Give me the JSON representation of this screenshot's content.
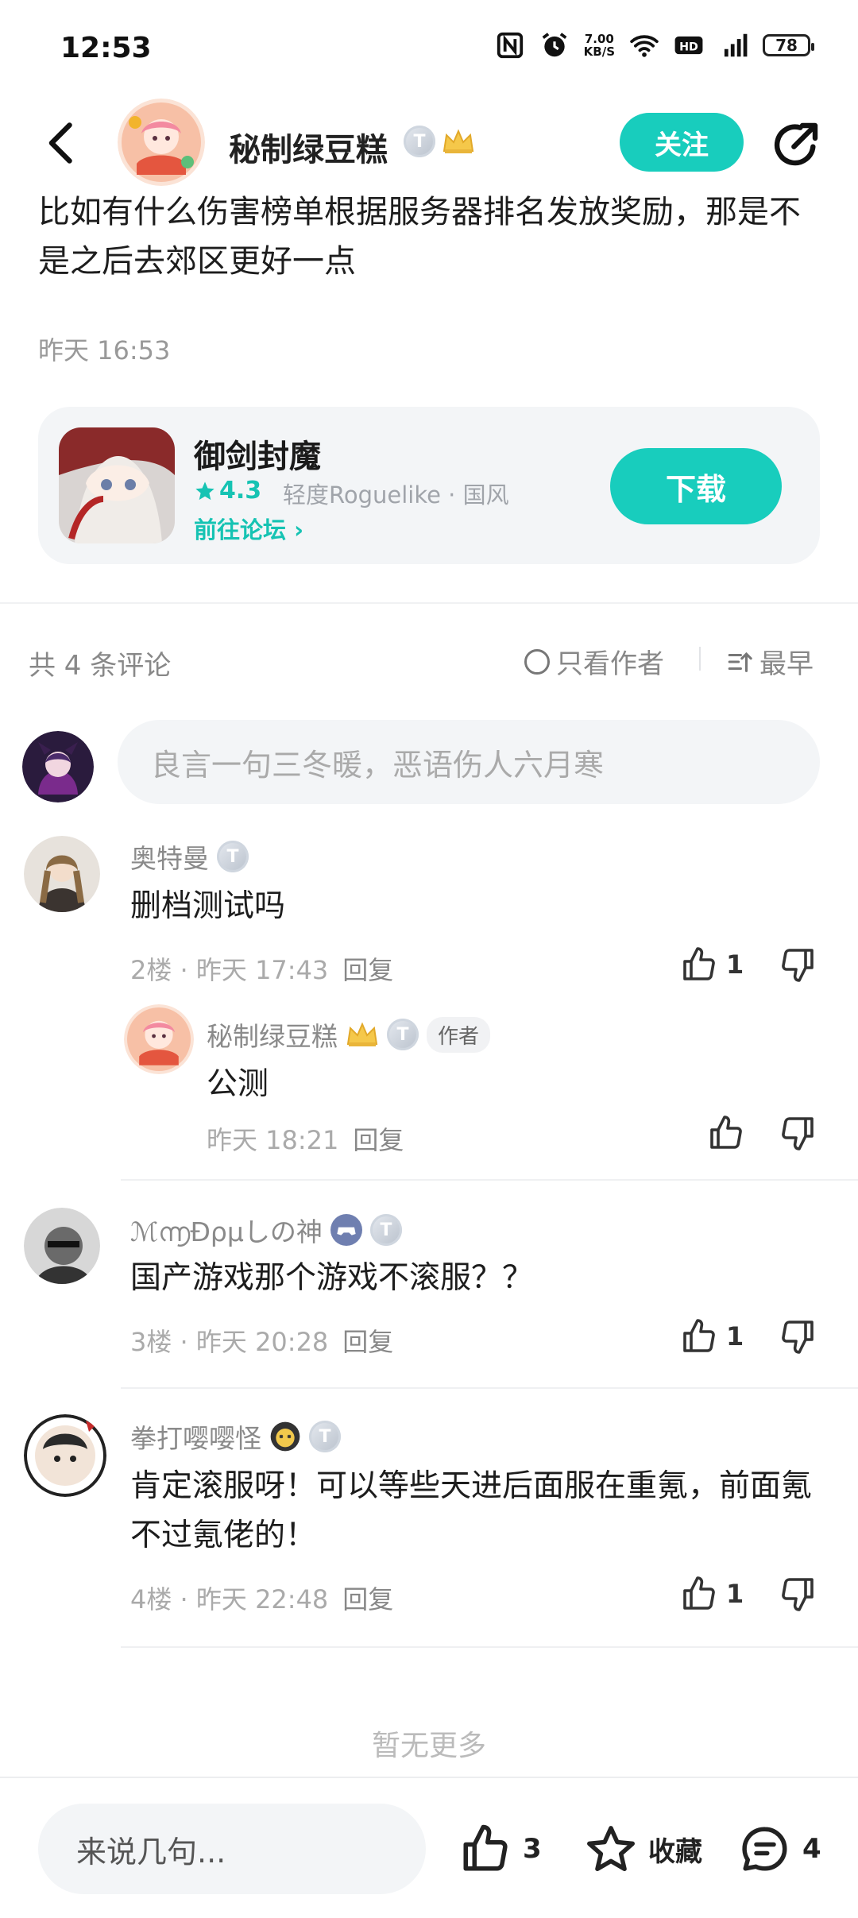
{
  "status_bar": {
    "time": "12:53",
    "net_speed": "7.00",
    "net_unit": "KB/S",
    "network": "5G",
    "battery": "78"
  },
  "header": {
    "author_name": "秘制绿豆糕",
    "badge_letter": "T",
    "follow_label": "关注"
  },
  "post": {
    "text": "比如有什么伤害榜单根据服务器排名发放奖励，那是不是之后去郊区更好一点",
    "time": "昨天 16:53"
  },
  "game_card": {
    "name": "御剑封魔",
    "rating": "4.3",
    "tags": "轻度Roguelike · 国风",
    "forum_link": "前往论坛",
    "download_label": "下载"
  },
  "comments_header": {
    "count": "共 4 条评论",
    "only_author": "只看作者",
    "sort": "最早"
  },
  "comment_input": {
    "placeholder": "良言一句三冬暖，恶语伤人六月寒"
  },
  "comments": [
    {
      "user": "奥特曼",
      "text": "删档测试吗",
      "floor": "2楼",
      "time": "昨天 17:43",
      "reply_label": "回复",
      "likes": "1",
      "reply": {
        "user": "秘制绿豆糕",
        "author_tag": "作者",
        "text": "公测",
        "time": "昨天 18:21",
        "reply_label": "回复"
      }
    },
    {
      "user": "ℳ൬Ɖρμしの神",
      "text": "国产游戏那个游戏不滚服？？",
      "floor": "3楼",
      "time": "昨天 20:28",
      "reply_label": "回复",
      "likes": "1"
    },
    {
      "user": "拳打嘤嘤怪",
      "text": "肯定滚服呀！可以等些天进后面服在重氪，前面氪不过氪佬的！",
      "floor": "4楼",
      "time": "昨天 22:48",
      "reply_label": "回复",
      "likes": "1"
    }
  ],
  "no_more": "暂无更多",
  "bottom_bar": {
    "input_placeholder": "来说几句...",
    "like_count": "3",
    "collect_label": "收藏",
    "comment_count": "4"
  },
  "colors": {
    "accent": "#18cdbd",
    "text": "#1d1d1d",
    "muted": "#999999",
    "card_bg": "#f3f5f7"
  }
}
